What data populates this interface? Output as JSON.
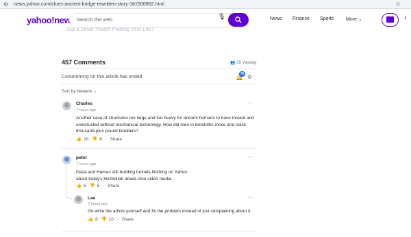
{
  "browser": {
    "url": "news.yahoo.com/clues-ancient-bridge-rewritten-story-161500962.html"
  },
  "header": {
    "logo": "yahoo!news",
    "search_placeholder": "Search the web",
    "nav": [
      "News",
      "Finance",
      "Sports",
      "More"
    ],
    "user_initial": "J"
  },
  "article": {
    "faint_text": "Eat a Small Thatch Prolong Your Life?"
  },
  "comments": {
    "title": "457 Comments",
    "viewing": "39 Viewing",
    "ended": "Commenting on this article has ended",
    "notification_count": "76",
    "sort_label": "Sort by Newest",
    "items": [
      {
        "user": "Charles",
        "time": "7 hours ago",
        "text": "Another case of structures too large and too heavy for ancient humans to have moved and constructed without mechanical technology. How did men in loincloths move and stack thousand-plus pound boulders?",
        "likes": "10",
        "dislikes": "8",
        "share": "Share"
      },
      {
        "user": "peter",
        "time": "7 hours ago",
        "text": "Gaza and Hamas still building tunnels.Nothing on Yahoo about today's Hezbollah attack.One sided media",
        "likes": "6",
        "dislikes": "6",
        "share": "Share"
      },
      {
        "user": "Lee",
        "time": "7 hours ago",
        "text": "Go write the article yourself and fix the problem instead of just complaining about it.",
        "likes": "8",
        "dislikes": "10",
        "share": "Share"
      }
    ]
  }
}
